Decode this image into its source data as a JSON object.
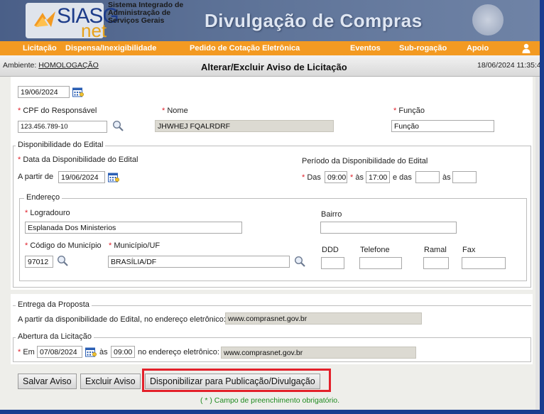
{
  "header": {
    "logo_main": "SIASG",
    "logo_net": "net",
    "logo_sub": [
      "Sistema Integrado de",
      "Administração de",
      "Serviços Gerais"
    ],
    "banner_title": "Divulgação de Compras"
  },
  "menu": {
    "items": [
      "Licitação",
      "Dispensa/Inexigibilidade",
      "Pedido de Cotação Eletrônica",
      "Eventos",
      "Sub-rogação",
      "Apoio"
    ]
  },
  "env": {
    "label": "Ambiente: ",
    "value": "HOMOLOGAÇÃO",
    "page_title": "Alterar/Excluir Aviso de Licitação",
    "datetime": "18/06/2024 11:35:4"
  },
  "top": {
    "date_value": "19/06/2024",
    "cpf_label": "CPF do Responsável",
    "cpf_value": "123.456.789-10",
    "nome_label": "Nome",
    "nome_value": "JHWHEJ FQALRDRF",
    "funcao_label": "Função",
    "funcao_value": "Função"
  },
  "disponibilidade": {
    "legend": "Disponibilidade do Edital",
    "data_label": "Data da Disponibilidade do Edital",
    "a_partir_label": "A partir de",
    "a_partir_value": "19/06/2024",
    "periodo_label": "Período da Disponibilidade do Edital",
    "das_label": "Das",
    "das_value": "09:00",
    "as_label": "às",
    "as_value": "17:00",
    "e_das_label": "e das",
    "e_das_value": "",
    "as2_label": "às",
    "as2_value": ""
  },
  "endereco": {
    "legend": "Endereço",
    "logradouro_label": "Logradouro",
    "logradouro_value": "Esplanada Dos Ministerios",
    "bairro_label": "Bairro",
    "bairro_value": "",
    "codigo_label": "Código do Município",
    "codigo_value": "97012",
    "municipio_label": "Município/UF",
    "municipio_value": "BRASÍLIA/DF",
    "ddd_label": "DDD",
    "telefone_label": "Telefone",
    "ramal_label": "Ramal",
    "fax_label": "Fax"
  },
  "entrega": {
    "legend": "Entrega da Proposta",
    "text": "A partir da disponibilidade do Edital, no endereço eletrônico:",
    "url": "www.comprasnet.gov.br"
  },
  "abertura": {
    "legend": "Abertura da Licitação",
    "em_label": "Em",
    "em_value": "07/08/2024",
    "as_label": "às",
    "as_value": "09:00",
    "endereco_label": "no endereço eletrônico:",
    "url": "www.comprasnet.gov.br"
  },
  "actions": {
    "salvar": "Salvar Aviso",
    "excluir": "Excluir Aviso",
    "disponibilizar": "Disponibilizar para Publicação/Divulgação"
  },
  "footnote": "( * ) Campo de preenchimento obrigatório.",
  "colors": {
    "menu": "#f39a22",
    "frame": "#1a3d8f",
    "highlight": "#e3202a",
    "required": "#e0202a"
  },
  "icons": [
    "calendar-icon",
    "search-icon",
    "user-icon",
    "brasao-crest"
  ]
}
